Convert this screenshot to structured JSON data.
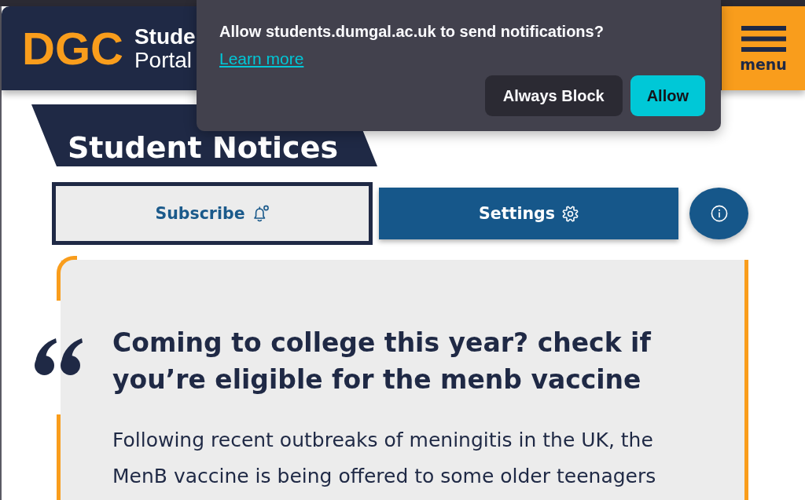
{
  "browser_prompt": {
    "message": "Allow students.dumgal.ac.uk to send notifications?",
    "link": "Learn more",
    "buttons": [
      {
        "kind": "secondary",
        "label": "Always Block"
      },
      {
        "kind": "primary",
        "label": "Allow"
      }
    ]
  },
  "header": {
    "logo": "DGC",
    "title_lines": [
      "Stude",
      "Portal"
    ],
    "menu_label": "menu"
  },
  "page_title": "Student Notices",
  "actions": [
    {
      "kind": "outline",
      "label": "Subscribe"
    },
    {
      "kind": "filled",
      "label": "Settings"
    },
    {
      "kind": "round"
    }
  ],
  "notice": {
    "heading": "Coming to college this year? check if you’re eligible for the menb vaccine",
    "body": "Following recent outbreaks of meningitis in the UK, the MenB vaccine is being offered to some older teenagers"
  }
}
